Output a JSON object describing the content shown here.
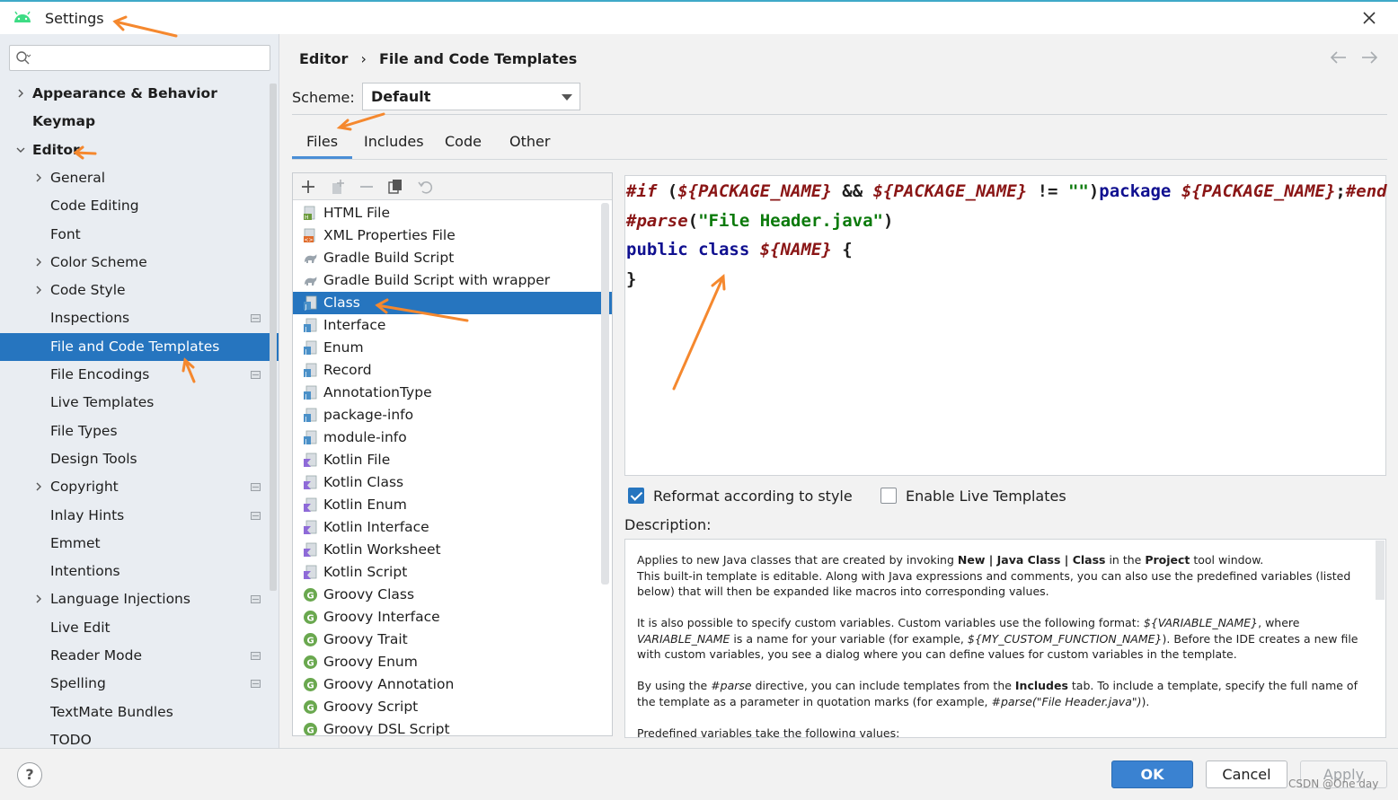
{
  "window": {
    "title": "Settings"
  },
  "search": {
    "placeholder": ""
  },
  "sidebar": {
    "items": [
      {
        "label": "Appearance & Behavior",
        "level": 0,
        "expandable": true,
        "expanded": false,
        "bold": true
      },
      {
        "label": "Keymap",
        "level": 0,
        "expandable": false,
        "bold": true
      },
      {
        "label": "Editor",
        "level": 0,
        "expandable": true,
        "expanded": true,
        "bold": true
      },
      {
        "label": "General",
        "level": 1,
        "expandable": true
      },
      {
        "label": "Code Editing",
        "level": 1
      },
      {
        "label": "Font",
        "level": 1
      },
      {
        "label": "Color Scheme",
        "level": 1,
        "expandable": true
      },
      {
        "label": "Code Style",
        "level": 1,
        "expandable": true
      },
      {
        "label": "Inspections",
        "level": 1,
        "badge": true
      },
      {
        "label": "File and Code Templates",
        "level": 1,
        "selected": true
      },
      {
        "label": "File Encodings",
        "level": 1,
        "badge": true
      },
      {
        "label": "Live Templates",
        "level": 1
      },
      {
        "label": "File Types",
        "level": 1
      },
      {
        "label": "Design Tools",
        "level": 1
      },
      {
        "label": "Copyright",
        "level": 1,
        "expandable": true,
        "badge": true
      },
      {
        "label": "Inlay Hints",
        "level": 1,
        "badge": true
      },
      {
        "label": "Emmet",
        "level": 1
      },
      {
        "label": "Intentions",
        "level": 1
      },
      {
        "label": "Language Injections",
        "level": 1,
        "expandable": true,
        "badge": true
      },
      {
        "label": "Live Edit",
        "level": 1
      },
      {
        "label": "Reader Mode",
        "level": 1,
        "badge": true
      },
      {
        "label": "Spelling",
        "level": 1,
        "badge": true
      },
      {
        "label": "TextMate Bundles",
        "level": 1
      },
      {
        "label": "TODO",
        "level": 1
      }
    ]
  },
  "breadcrumb": {
    "parent": "Editor",
    "separator": "›",
    "current": "File and Code Templates"
  },
  "scheme": {
    "label": "Scheme:",
    "value": "Default"
  },
  "tabs": [
    {
      "label": "Files",
      "active": true
    },
    {
      "label": "Includes"
    },
    {
      "label": "Code"
    },
    {
      "label": "Other"
    }
  ],
  "templates": [
    {
      "label": "HTML File",
      "icon": "html-file-icon"
    },
    {
      "label": "XML Properties File",
      "icon": "xml-file-icon"
    },
    {
      "label": "Gradle Build Script",
      "icon": "gradle-icon"
    },
    {
      "label": "Gradle Build Script with wrapper",
      "icon": "gradle-icon"
    },
    {
      "label": "Class",
      "icon": "java-file-icon",
      "selected": true
    },
    {
      "label": "Interface",
      "icon": "java-file-icon"
    },
    {
      "label": "Enum",
      "icon": "java-file-icon"
    },
    {
      "label": "Record",
      "icon": "java-file-icon"
    },
    {
      "label": "AnnotationType",
      "icon": "java-file-icon"
    },
    {
      "label": "package-info",
      "icon": "java-file-icon"
    },
    {
      "label": "module-info",
      "icon": "java-file-icon"
    },
    {
      "label": "Kotlin File",
      "icon": "kotlin-file-icon"
    },
    {
      "label": "Kotlin Class",
      "icon": "kotlin-file-icon"
    },
    {
      "label": "Kotlin Enum",
      "icon": "kotlin-file-icon"
    },
    {
      "label": "Kotlin Interface",
      "icon": "kotlin-file-icon"
    },
    {
      "label": "Kotlin Worksheet",
      "icon": "kotlin-file-icon"
    },
    {
      "label": "Kotlin Script",
      "icon": "kotlin-file-icon"
    },
    {
      "label": "Groovy Class",
      "icon": "groovy-icon"
    },
    {
      "label": "Groovy Interface",
      "icon": "groovy-icon"
    },
    {
      "label": "Groovy Trait",
      "icon": "groovy-icon"
    },
    {
      "label": "Groovy Enum",
      "icon": "groovy-icon"
    },
    {
      "label": "Groovy Annotation",
      "icon": "groovy-icon"
    },
    {
      "label": "Groovy Script",
      "icon": "groovy-icon"
    },
    {
      "label": "Groovy DSL Script",
      "icon": "groovy-icon"
    }
  ],
  "editor": {
    "lines": [
      [
        {
          "t": "#if",
          "c": "kw-dir"
        },
        {
          "t": " (",
          "c": "pl"
        },
        {
          "t": "${PACKAGE_NAME}",
          "c": "kw-var"
        },
        {
          "t": " && ",
          "c": "pl"
        },
        {
          "t": "${PACKAGE_NAME}",
          "c": "kw-var"
        },
        {
          "t": " != ",
          "c": "pl"
        },
        {
          "t": "\"\"",
          "c": "str"
        },
        {
          "t": ")",
          "c": "pl"
        },
        {
          "t": "package",
          "c": "kw"
        },
        {
          "t": " ",
          "c": "pl"
        },
        {
          "t": "${PACKAGE_NAME}",
          "c": "kw-var"
        },
        {
          "t": ";",
          "c": "pl"
        },
        {
          "t": "#end",
          "c": "kw-dir"
        }
      ],
      [
        {
          "t": "#parse",
          "c": "kw-dir"
        },
        {
          "t": "(",
          "c": "pl"
        },
        {
          "t": "\"File Header.java\"",
          "c": "str"
        },
        {
          "t": ")",
          "c": "pl"
        }
      ],
      [
        {
          "t": "public class",
          "c": "kw"
        },
        {
          "t": " ",
          "c": "pl"
        },
        {
          "t": "${NAME}",
          "c": "kw-var"
        },
        {
          "t": " {",
          "c": "pl"
        }
      ],
      [
        {
          "t": "}",
          "c": "pl"
        }
      ]
    ]
  },
  "options": {
    "reformat": {
      "label": "Reformat according to style",
      "checked": true
    },
    "live_templates": {
      "label": "Enable Live Templates",
      "checked": false
    }
  },
  "description": {
    "label": "Description:",
    "paragraphs": [
      [
        {
          "t": "Applies to new Java classes that are created by invoking "
        },
        {
          "t": "New | Java Class | Class",
          "s": "b"
        },
        {
          "t": " in the "
        },
        {
          "t": "Project",
          "s": "b"
        },
        {
          "t": " tool window."
        },
        {
          "br": true
        },
        {
          "t": "This built-in template is editable. Along with Java expressions and comments, you can also use the predefined variables (listed below) that will then be expanded like macros into corresponding values."
        }
      ],
      [
        {
          "t": "It is also possible to specify custom variables. Custom variables use the following format: "
        },
        {
          "t": "${VARIABLE_NAME}",
          "s": "i"
        },
        {
          "t": ", where "
        },
        {
          "t": "VARIABLE_NAME",
          "s": "i"
        },
        {
          "t": " is a name for your variable (for example, "
        },
        {
          "t": "${MY_CUSTOM_FUNCTION_NAME}",
          "s": "i"
        },
        {
          "t": "). Before the IDE creates a new file with custom variables, you see a dialog where you can define values for custom variables in the template."
        }
      ],
      [
        {
          "t": "By using the "
        },
        {
          "t": "#parse",
          "s": "i"
        },
        {
          "t": " directive, you can include templates from the "
        },
        {
          "t": "Includes",
          "s": "b"
        },
        {
          "t": " tab. To include a template, specify the full name of the template as a parameter in quotation marks (for example, "
        },
        {
          "t": "#parse(\"File Header.java\")",
          "s": "i"
        },
        {
          "t": ")."
        }
      ],
      [
        {
          "t": "Predefined variables take the following values:"
        }
      ]
    ]
  },
  "buttons": {
    "ok": "OK",
    "cancel": "Cancel",
    "apply": "Apply",
    "help": "?"
  },
  "watermark": "CSDN @One day",
  "colors": {
    "accent": "#2675bf",
    "annotation": "#f5882e"
  }
}
